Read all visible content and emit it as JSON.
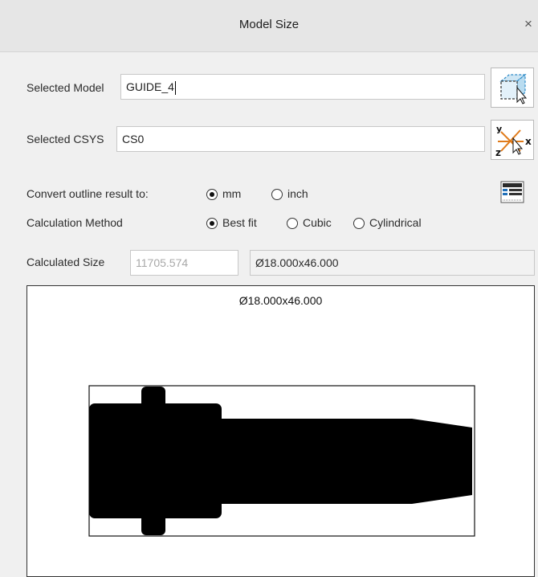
{
  "window": {
    "title": "Model Size",
    "close_glyph": "×"
  },
  "selected_model": {
    "label": "Selected Model",
    "value": "GUIDE_4"
  },
  "selected_csys": {
    "label": "Selected CSYS",
    "value": "CS0"
  },
  "convert_outline": {
    "label": "Convert outline result to:",
    "options": [
      {
        "label": "mm",
        "checked": true
      },
      {
        "label": "inch",
        "checked": false
      }
    ]
  },
  "calculation_method": {
    "label": "Calculation Method",
    "options": [
      {
        "label": "Best fit",
        "checked": true
      },
      {
        "label": "Cubic",
        "checked": false
      },
      {
        "label": "Cylindrical",
        "checked": false
      }
    ]
  },
  "calculated_size": {
    "label": "Calculated Size",
    "volume": "11705.574",
    "size": "Ø18.000x46.000"
  },
  "preview": {
    "caption": "Ø18.000x46.000"
  },
  "icons": {
    "model_select": "box-select-icon",
    "csys_select": "csys-axes-icon",
    "table": "table-icon"
  }
}
